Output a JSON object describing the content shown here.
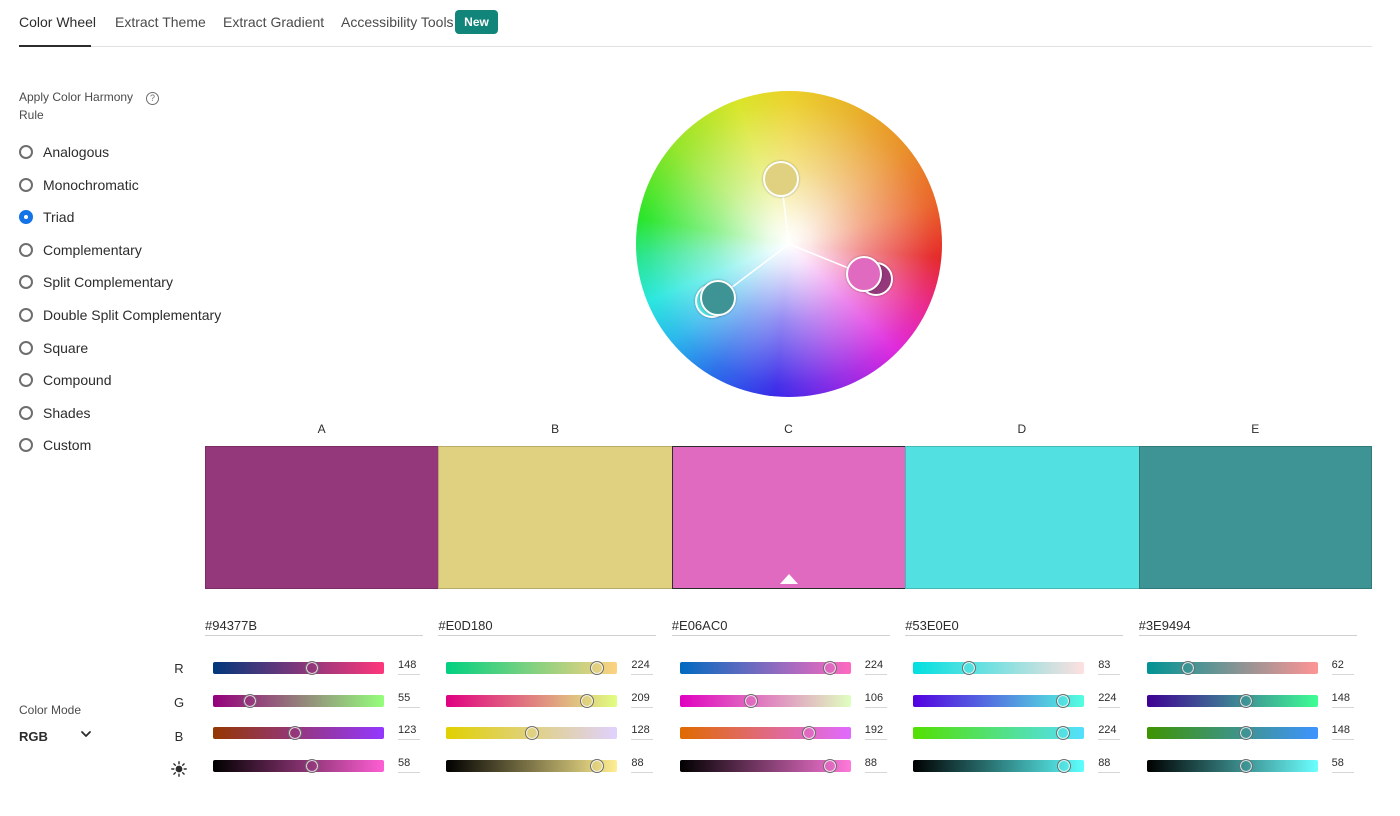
{
  "tabs": {
    "items": [
      {
        "label": "Color Wheel",
        "active": true
      },
      {
        "label": "Extract Theme"
      },
      {
        "label": "Extract Gradient"
      },
      {
        "label": "Accessibility Tools"
      }
    ],
    "badge": "New"
  },
  "harmony": {
    "title": "Apply Color Harmony Rule",
    "help_icon": "help-icon",
    "options": [
      "Analogous",
      "Monochromatic",
      "Triad",
      "Complementary",
      "Split Complementary",
      "Double Split Complementary",
      "Square",
      "Compound",
      "Shades",
      "Custom"
    ],
    "selected": "Triad"
  },
  "swatches": [
    {
      "letter": "A",
      "hex": "#94377B",
      "r": 148,
      "g": 55,
      "b": 123,
      "brightness": 58
    },
    {
      "letter": "B",
      "hex": "#E0D180",
      "r": 224,
      "g": 209,
      "b": 128,
      "brightness": 88
    },
    {
      "letter": "C",
      "hex": "#E06AC0",
      "r": 224,
      "g": 106,
      "b": 192,
      "brightness": 88,
      "selected": true
    },
    {
      "letter": "D",
      "hex": "#53E0E0",
      "r": 83,
      "g": 224,
      "b": 224,
      "brightness": 88
    },
    {
      "letter": "E",
      "hex": "#3E9494",
      "r": 62,
      "g": 148,
      "b": 148,
      "brightness": 58
    }
  ],
  "channels": {
    "r": "R",
    "g": "G",
    "b": "B",
    "brightness_icon": "brightness-icon"
  },
  "color_mode": {
    "title": "Color Mode",
    "value": "RGB"
  }
}
